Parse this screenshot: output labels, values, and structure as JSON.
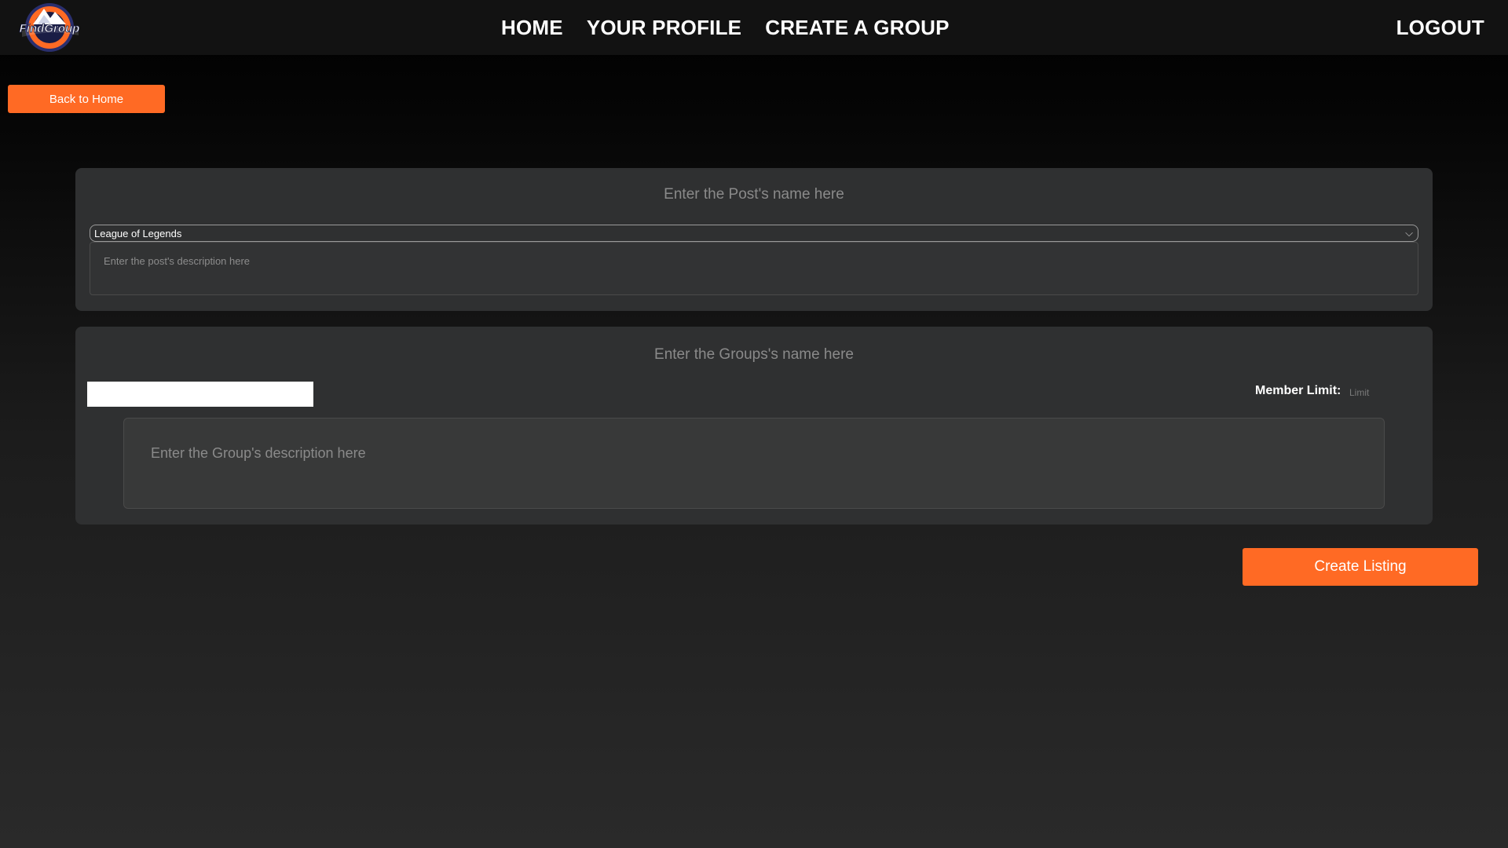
{
  "app": {
    "logo_text": "FindGroup"
  },
  "nav": {
    "home": "HOME",
    "profile": "YOUR PROFILE",
    "create_group": "CREATE A GROUP",
    "logout": "LOGOUT"
  },
  "back_button": "Back to Home",
  "post": {
    "name_placeholder": "Enter the Post's name here",
    "game_selected": "League of Legends",
    "description_placeholder": "Enter the post's description here"
  },
  "group": {
    "name_placeholder": "Enter the Groups's name here",
    "member_limit_label": "Member Limit:",
    "limit_placeholder": "Limit",
    "description_placeholder": "Enter the Group's description here"
  },
  "create_button": "Create Listing",
  "colors": {
    "accent": "#ff6a24",
    "card": "#2f3031",
    "topbar": "#121212"
  }
}
